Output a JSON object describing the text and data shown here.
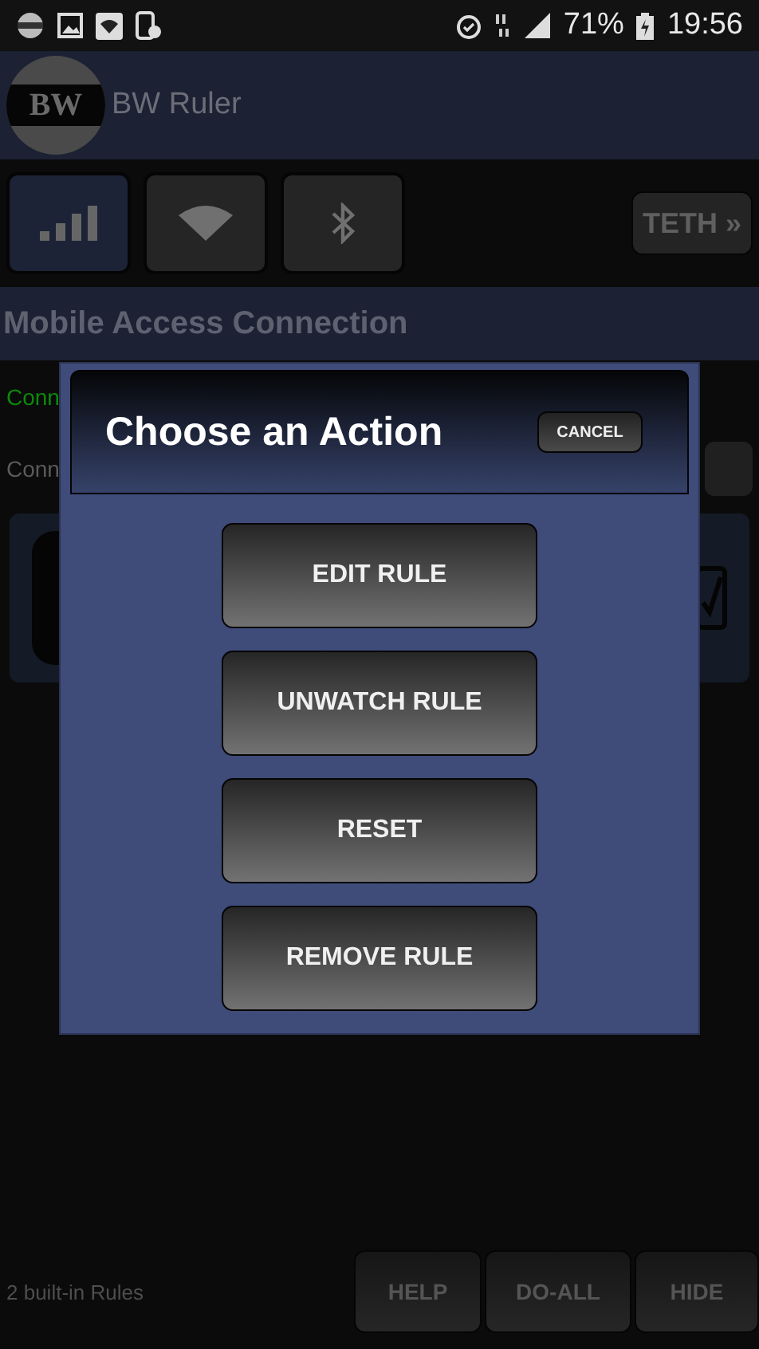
{
  "status_bar": {
    "battery": "71%",
    "time": "19:56"
  },
  "app_bar": {
    "logo": "BW",
    "title": "BW Ruler"
  },
  "tabs": [
    {
      "kind": "signal",
      "selected": true
    },
    {
      "kind": "wifi",
      "selected": false
    },
    {
      "kind": "bluetooth",
      "selected": false
    }
  ],
  "tether_button": "TETH »",
  "section_title": "Mobile Access Connection",
  "rows": [
    {
      "kind": "status",
      "text": "Conn"
    },
    {
      "kind": "setting",
      "text": "Conn"
    }
  ],
  "rule_card": {
    "checked": true
  },
  "dialog": {
    "title": "Choose an Action",
    "cancel": "CANCEL",
    "actions": [
      "EDIT RULE",
      "UNWATCH RULE",
      "RESET",
      "REMOVE RULE"
    ]
  },
  "footer": {
    "info": "2 built-in Rules",
    "buttons": [
      "HELP",
      "DO-ALL",
      "HIDE"
    ]
  }
}
